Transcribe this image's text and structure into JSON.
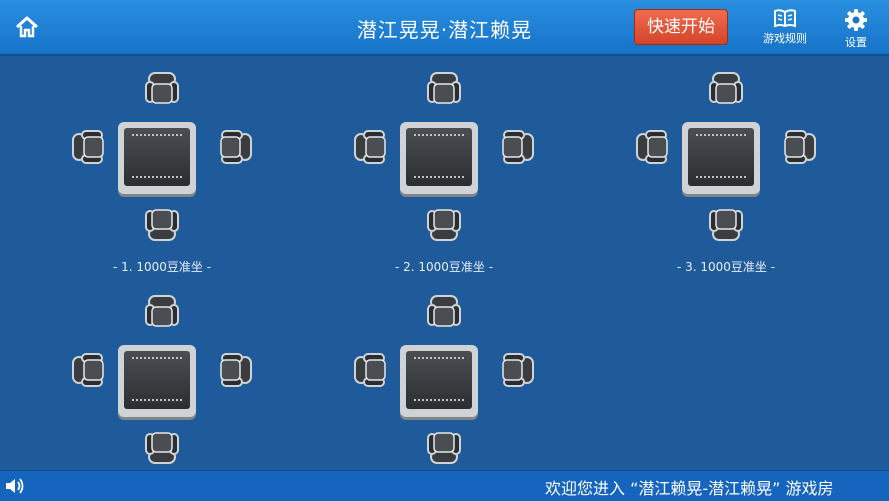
{
  "header": {
    "home_icon": "home-icon",
    "title": "潜江晃晃·潜江赖晃",
    "quick_start_label": "快速开始",
    "rules_label": "游戏规则",
    "rules_icon": "book-icon",
    "settings_label": "设置",
    "settings_icon": "gear-icon"
  },
  "tables": [
    {
      "label": "- 1. 1000豆准坐 -"
    },
    {
      "label": "- 2. 1000豆准坐 -"
    },
    {
      "label": "- 3. 1000豆准坐 -"
    },
    {
      "label": ""
    },
    {
      "label": ""
    }
  ],
  "footer": {
    "speaker_icon": "speaker-icon",
    "marquee": "欢迎您进入 “潜江赖晃-潜江赖晃” 游戏房"
  },
  "colors": {
    "background": "#1f5a9b",
    "header": "#1673c8",
    "quick_start": "#e0553a",
    "footer": "#1565bf"
  }
}
